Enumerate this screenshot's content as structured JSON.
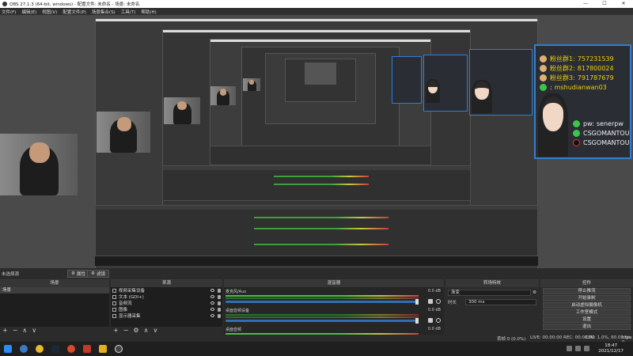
{
  "window": {
    "title": "OBS 27.1.3 (64-bit, windows) - 配置文件: 未命名 - 场景: 未命名",
    "minimize": "—",
    "maximize": "☐",
    "close": "✕"
  },
  "menu": [
    "文件(F)",
    "编辑(E)",
    "视图(V)",
    "配置文件(P)",
    "场景集合(S)",
    "工具(T)",
    "帮助(H)"
  ],
  "info_panel": {
    "rows": [
      {
        "label": "粉丝群1:",
        "value": "757231539",
        "icon": "qq-icon"
      },
      {
        "label": "粉丝群2:",
        "value": "817800024",
        "icon": "qq-icon"
      },
      {
        "label": "粉丝群3:",
        "value": "791787679",
        "icon": "qq-icon"
      },
      {
        "label": ":",
        "value": "mshudianwan03",
        "icon": "wechat-icon"
      },
      {
        "label": "pw:",
        "value": "senerpw",
        "icon": "wechat-icon"
      },
      {
        "label": "",
        "value": "CSGOMANTOU",
        "icon": "wechat-icon"
      },
      {
        "label": "",
        "value": "CSGOMANTOU",
        "icon": "tiktok-icon"
      }
    ]
  },
  "scene_bar": {
    "current": "未选择源",
    "properties_btn": "属性",
    "filters_btn": "滤镜"
  },
  "docks": {
    "scenes": {
      "title": "场景",
      "items": [
        "场景"
      ]
    },
    "sources": {
      "title": "来源",
      "items": [
        {
          "name": "视频采集设备",
          "icon": "camera-icon"
        },
        {
          "name": "文本 (GDI+)",
          "icon": "text-icon"
        },
        {
          "name": "音频流",
          "icon": "audio-icon"
        },
        {
          "name": "图像",
          "icon": "image-icon"
        },
        {
          "name": "显示器采集",
          "icon": "monitor-icon"
        }
      ]
    },
    "mixer": {
      "title": "混音器",
      "channels": [
        {
          "name": "麦克风/Aux",
          "db": "0.0 dB"
        },
        {
          "name": "桌面音频设备",
          "db": "0.0 dB"
        },
        {
          "name": "桌面音频",
          "db": "0.0 dB"
        }
      ]
    },
    "transitions": {
      "title": "转场特效",
      "effect": "渐变",
      "duration_label": "时长",
      "duration": "300 ms"
    },
    "controls": {
      "title": "控件",
      "buttons": [
        "停止推流",
        "开始录制",
        "启动虚拟摄像机",
        "工作室模式",
        "设置",
        "退出"
      ]
    }
  },
  "footer_icons": {
    "add": "+",
    "remove": "−",
    "settings": "⚙",
    "up": "∧",
    "down": "∨"
  },
  "status": {
    "dropped": "丢帧 0 (0.0%)",
    "live": "LIVE: 00:00:00",
    "rec": "REC: 00:00:00",
    "cpu": "CPU: 1.0%, 60.00 fps",
    "kbps": "kb/s: 0"
  },
  "taskbar": {
    "time": "18:47",
    "date": "2021/12/17"
  },
  "colors": {
    "panel_border": "#2e7fd6",
    "info_text": "#f0d000",
    "meter_green": "#44c044",
    "fader_blue": "#2e6fb8"
  }
}
